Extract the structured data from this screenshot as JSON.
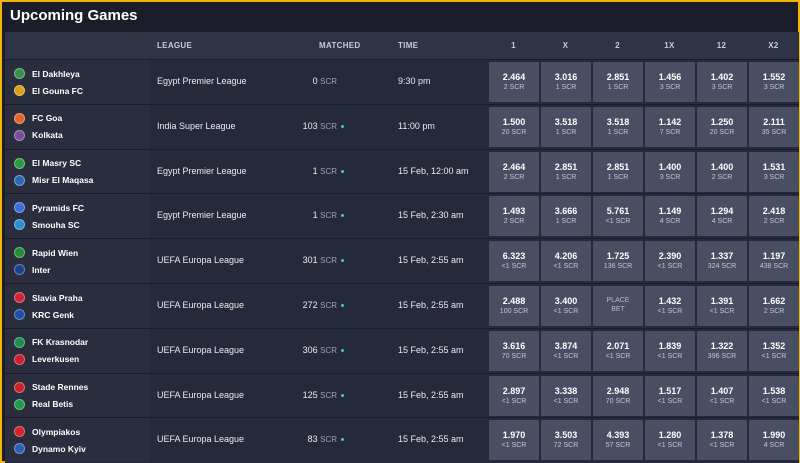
{
  "title": "Upcoming Games",
  "columns": {
    "league": "LEAGUE",
    "matched": "MATCHED",
    "time": "TIME",
    "odds": [
      "1",
      "X",
      "2",
      "1X",
      "12",
      "X2"
    ]
  },
  "games": [
    {
      "team1": "El Dakhleya",
      "team2": "El Gouna FC",
      "crest1": "#3a8f4a",
      "crest2": "#d9a21c",
      "league": "Egypt Premier League",
      "matched": "0",
      "unit": "SCR",
      "live": false,
      "time": "9:30 pm",
      "odds": [
        [
          "2.464",
          "2 SCR"
        ],
        [
          "3.016",
          "1 SCR"
        ],
        [
          "2.851",
          "1 SCR"
        ],
        [
          "1.456",
          "3 SCR"
        ],
        [
          "1.402",
          "3 SCR"
        ],
        [
          "1.552",
          "3 SCR"
        ]
      ]
    },
    {
      "team1": "FC Goa",
      "team2": "Kolkata",
      "crest1": "#e2672a",
      "crest2": "#7a4c9e",
      "league": "India Super League",
      "matched": "103",
      "unit": "SCR",
      "live": true,
      "time": "11:00 pm",
      "odds": [
        [
          "1.500",
          "20 SCR"
        ],
        [
          "3.518",
          "1 SCR"
        ],
        [
          "3.518",
          "1 SCR"
        ],
        [
          "1.142",
          "7 SCR"
        ],
        [
          "1.250",
          "20 SCR"
        ],
        [
          "2.111",
          "35 SCR"
        ]
      ]
    },
    {
      "team1": "El Masry SC",
      "team2": "Misr El Maqasa",
      "crest1": "#2e9a3e",
      "crest2": "#2f6ab0",
      "league": "Egypt Premier League",
      "matched": "1",
      "unit": "SCR",
      "live": true,
      "time": "15 Feb, 12:00 am",
      "odds": [
        [
          "2.464",
          "2 SCR"
        ],
        [
          "2.851",
          "1 SCR"
        ],
        [
          "2.851",
          "1 SCR"
        ],
        [
          "1.400",
          "3 SCR"
        ],
        [
          "1.400",
          "2 SCR"
        ],
        [
          "1.531",
          "3 SCR"
        ]
      ]
    },
    {
      "team1": "Pyramids FC",
      "team2": "Smouha SC",
      "crest1": "#3c6fd6",
      "crest2": "#2b8fd1",
      "league": "Egypt Premier League",
      "matched": "1",
      "unit": "SCR",
      "live": true,
      "time": "15 Feb, 2:30 am",
      "odds": [
        [
          "1.493",
          "2 SCR"
        ],
        [
          "3.666",
          "1 SCR"
        ],
        [
          "5.761",
          "<1 SCR"
        ],
        [
          "1.149",
          "4 SCR"
        ],
        [
          "1.294",
          "4 SCR"
        ],
        [
          "2.418",
          "2 SCR"
        ]
      ]
    },
    {
      "team1": "Rapid Wien",
      "team2": "Inter",
      "crest1": "#2a8a3a",
      "crest2": "#1c3f8c",
      "league": "UEFA Europa League",
      "matched": "301",
      "unit": "SCR",
      "live": true,
      "time": "15 Feb, 2:55 am",
      "odds": [
        [
          "6.323",
          "<1 SCR"
        ],
        [
          "4.206",
          "<1 SCR"
        ],
        [
          "1.725",
          "136 SCR"
        ],
        [
          "2.390",
          "<1 SCR"
        ],
        [
          "1.337",
          "324 SCR"
        ],
        [
          "1.197",
          "438 SCR"
        ]
      ]
    },
    {
      "team1": "Slavia Praha",
      "team2": "KRC Genk",
      "crest1": "#d0263a",
      "crest2": "#1d4fa8",
      "league": "UEFA Europa League",
      "matched": "272",
      "unit": "SCR",
      "live": true,
      "time": "15 Feb, 2:55 am",
      "odds": [
        [
          "2.488",
          "100 SCR"
        ],
        [
          "3.400",
          "<1 SCR"
        ],
        [
          "PLACE",
          "BET"
        ],
        [
          "1.432",
          "<1 SCR"
        ],
        [
          "1.391",
          "<1 SCR"
        ],
        [
          "1.662",
          "2 SCR"
        ]
      ]
    },
    {
      "team1": "FK Krasnodar",
      "team2": "Leverkusen",
      "crest1": "#1f8c4a",
      "crest2": "#c8202f",
      "league": "UEFA Europa League",
      "matched": "306",
      "unit": "SCR",
      "live": true,
      "time": "15 Feb, 2:55 am",
      "odds": [
        [
          "3.616",
          "70 SCR"
        ],
        [
          "3.874",
          "<1 SCR"
        ],
        [
          "2.071",
          "<1 SCR"
        ],
        [
          "1.839",
          "<1 SCR"
        ],
        [
          "1.322",
          "396 SCR"
        ],
        [
          "1.352",
          "<1 SCR"
        ]
      ]
    },
    {
      "team1": "Stade Rennes",
      "team2": "Real Betis",
      "crest1": "#c6222c",
      "crest2": "#1f9a4a",
      "league": "UEFA Europa League",
      "matched": "125",
      "unit": "SCR",
      "live": true,
      "time": "15 Feb, 2:55 am",
      "odds": [
        [
          "2.897",
          "<1 SCR"
        ],
        [
          "3.338",
          "<1 SCR"
        ],
        [
          "2.948",
          "70 SCR"
        ],
        [
          "1.517",
          "<1 SCR"
        ],
        [
          "1.407",
          "<1 SCR"
        ],
        [
          "1.538",
          "<1 SCR"
        ]
      ]
    },
    {
      "team1": "Olympiakos",
      "team2": "Dynamo Kyiv",
      "crest1": "#d3232d",
      "crest2": "#2b5fb8",
      "league": "UEFA Europa League",
      "matched": "83",
      "unit": "SCR",
      "live": true,
      "time": "15 Feb, 2:55 am",
      "odds": [
        [
          "1.970",
          "<1 SCR"
        ],
        [
          "3.503",
          "72 SCR"
        ],
        [
          "4.393",
          "57 SCR"
        ],
        [
          "1.280",
          "<1 SCR"
        ],
        [
          "1.378",
          "<1 SCR"
        ],
        [
          "1.990",
          "4 SCR"
        ]
      ]
    }
  ]
}
